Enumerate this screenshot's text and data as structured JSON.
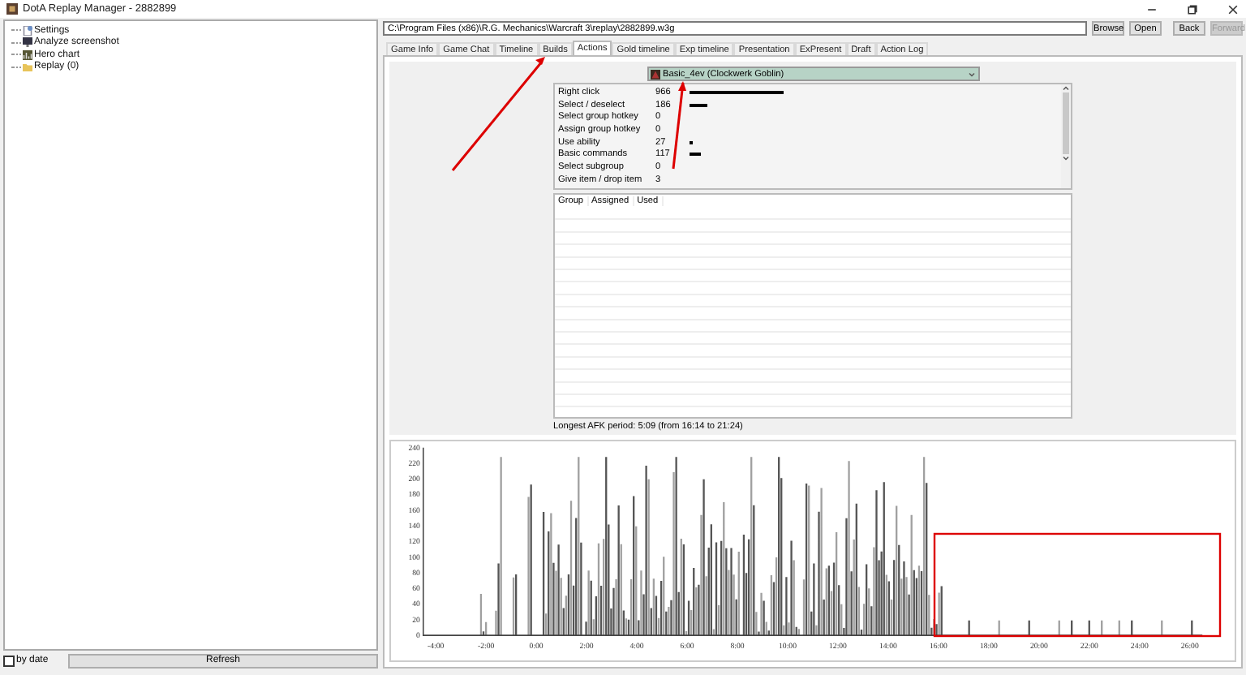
{
  "window": {
    "title": "DotA Replay Manager - 2882899"
  },
  "tree": [
    {
      "label": "Settings",
      "kind": "settings"
    },
    {
      "label": "Analyze screenshot",
      "kind": "screenshot"
    },
    {
      "label": "Hero chart",
      "kind": "chart"
    },
    {
      "label": "Replay (0)",
      "kind": "folder"
    }
  ],
  "sort_by_date": {
    "label": "by date",
    "checked": false
  },
  "refresh_button": "Refresh",
  "path_field": {
    "value": "C:\\Program Files (x86)\\R.G. Mechanics\\Warcraft 3\\replay\\2882899.w3g"
  },
  "nav_buttons": [
    {
      "label": "Browse",
      "disabled": false
    },
    {
      "label": "Open",
      "disabled": false
    },
    {
      "label": "Back",
      "disabled": false
    },
    {
      "label": "Forward",
      "disabled": true
    }
  ],
  "tabs": [
    {
      "label": "Game Info",
      "selected": false
    },
    {
      "label": "Game Chat",
      "selected": false
    },
    {
      "label": "Timeline",
      "selected": false
    },
    {
      "label": "Builds",
      "selected": false
    },
    {
      "label": "Actions",
      "selected": true
    },
    {
      "label": "Gold timeline",
      "selected": false
    },
    {
      "label": "Exp timeline",
      "selected": false
    },
    {
      "label": "Presentation",
      "selected": false
    },
    {
      "label": "ExPresent",
      "selected": false
    },
    {
      "label": "Draft",
      "selected": false
    },
    {
      "label": "Action Log",
      "selected": false
    }
  ],
  "player_dropdown": {
    "value": "Basic_4ev (Clockwerk Goblin)"
  },
  "actions": [
    {
      "name": "Right click",
      "count": "966"
    },
    {
      "name": "Select / deselect",
      "count": "186"
    },
    {
      "name": "Select group hotkey",
      "count": "0"
    },
    {
      "name": "Assign group hotkey",
      "count": "0"
    },
    {
      "name": "Use ability",
      "count": "27"
    },
    {
      "name": "Basic commands",
      "count": "117"
    },
    {
      "name": "Select subgroup",
      "count": "0"
    },
    {
      "name": "Give item / drop item",
      "count": "3"
    }
  ],
  "group_table": {
    "columns": [
      "Group",
      "Assigned",
      "Used"
    ]
  },
  "afk_note": "Longest AFK period: 5:09 (from 16:14 to 21:24)",
  "apm_chart": {
    "yticks": [
      "240",
      "220",
      "200",
      "180",
      "160",
      "140",
      "120",
      "100",
      "80",
      "60",
      "40",
      "20",
      "0"
    ],
    "xticks": [
      "-4:00",
      "-2:00",
      "0:00",
      "2:00",
      "4:00",
      "6:00",
      "8:00",
      "10:00",
      "12:00",
      "14:00",
      "16:00",
      "18:00",
      "20:00",
      "22:00",
      "24:00",
      "26:00"
    ]
  }
}
